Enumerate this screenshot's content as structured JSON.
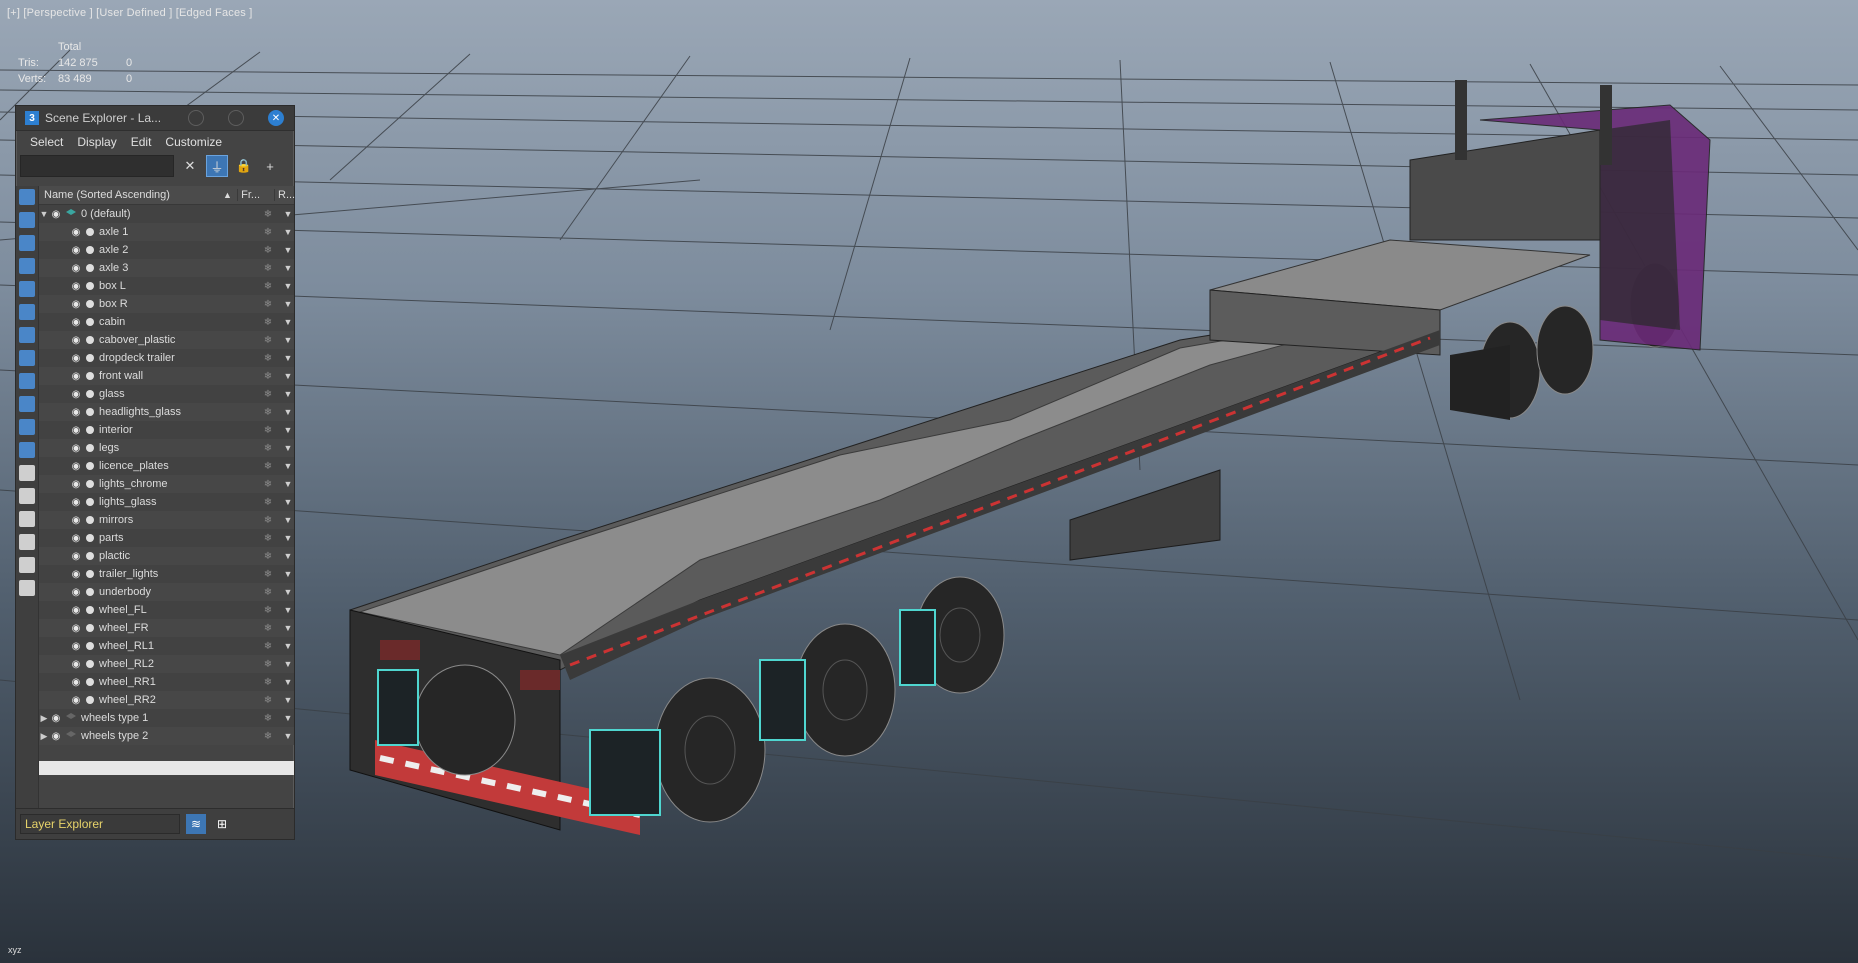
{
  "viewport": {
    "label": "[+] [Perspective ] [User Defined ] [Edged Faces ]",
    "stats": {
      "header": "Total",
      "rows": [
        {
          "key": "Tris:",
          "total": "142 875",
          "sel": "0"
        },
        {
          "key": "Verts:",
          "total": "83 489",
          "sel": "0"
        }
      ]
    }
  },
  "explorer": {
    "title": "Scene Explorer - La...",
    "app_icon": "3",
    "menu": [
      "Select",
      "Display",
      "Edit",
      "Customize"
    ],
    "search_placeholder": "",
    "columns": {
      "name": "Name (Sorted Ascending)",
      "sort_arrow": "▲",
      "freeze": "Fr...",
      "render": "R..."
    },
    "default_layer": "0 (default)",
    "objects": [
      "axle 1",
      "axle 2",
      "axle 3",
      "box L",
      "box R",
      "cabin",
      "cabover_plastic",
      "dropdeck trailer",
      "front wall",
      "glass",
      "headlights_glass",
      "interior",
      "legs",
      "licence_plates",
      "lights_chrome",
      "lights_glass",
      "mirrors",
      "parts",
      "plactic",
      "trailer_lights",
      "underbody",
      "wheel_FL",
      "wheel_FR",
      "wheel_RL1",
      "wheel_RL2",
      "wheel_RR1",
      "wheel_RR2"
    ],
    "layers": [
      "wheels type 1",
      "wheels type 2"
    ],
    "bottom_combo": "Layer Explorer"
  },
  "colors": {
    "accent": "#3d76b4",
    "layer_combo_text": "#e7d36a",
    "cab": "#6a2a78"
  }
}
